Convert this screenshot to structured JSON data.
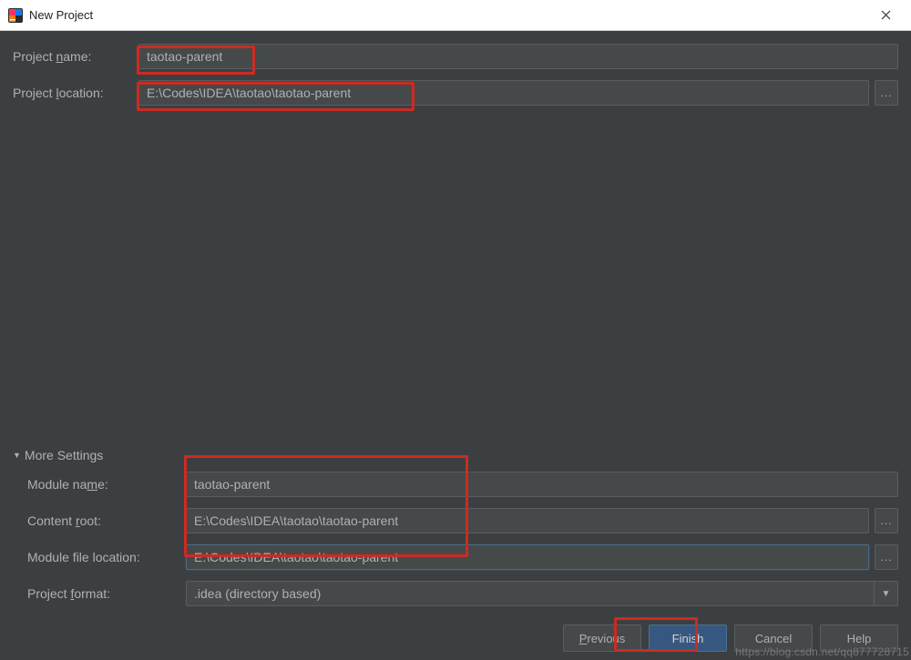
{
  "window": {
    "title": "New Project"
  },
  "fields": {
    "project_name": {
      "label": "Project name:",
      "value": "taotao-parent",
      "mn_index": 8
    },
    "project_location": {
      "label": "Project location:",
      "value": "E:\\Codes\\IDEA\\taotao\\taotao-parent",
      "mn_index": 8
    }
  },
  "more_settings": {
    "label": "More Settings",
    "expanded": true,
    "module_name": {
      "label": "Module name:",
      "value": "taotao-parent"
    },
    "content_root": {
      "label": "Content root:",
      "value": "E:\\Codes\\IDEA\\taotao\\taotao-parent"
    },
    "module_file_location": {
      "label": "Module file location:",
      "value": "E:\\Codes\\IDEA\\taotao\\taotao-parent"
    },
    "project_format": {
      "label": "Project format:",
      "value": ".idea (directory based)"
    }
  },
  "buttons": {
    "previous": "Previous",
    "finish": "Finish",
    "cancel": "Cancel",
    "help": "Help"
  },
  "watermark": "https://blog.csdn.net/qq877728715"
}
